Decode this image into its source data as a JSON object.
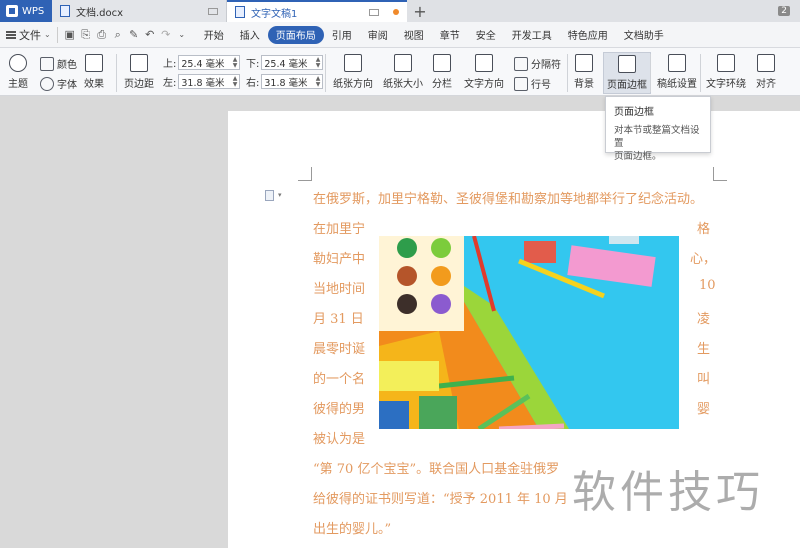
{
  "titlebar": {
    "app_name": "WPS",
    "tabs": [
      {
        "label": "文档.docx"
      },
      {
        "label": "文字文稿1"
      }
    ],
    "badge": "2"
  },
  "menubar": {
    "file_label": "文件",
    "items": [
      "开始",
      "插入",
      "页面布局",
      "引用",
      "审阅",
      "视图",
      "章节",
      "安全",
      "开发工具",
      "特色应用",
      "文档助手"
    ],
    "active": "页面布局"
  },
  "ribbon": {
    "theme": "主题",
    "color": "颜色",
    "font": "字体",
    "effect": "效果",
    "margins": "页边距",
    "top_label": "上:",
    "top_value": "25.4 毫米",
    "bottom_label": "下:",
    "bottom_value": "25.4 毫米",
    "left_label": "左:",
    "left_value": "31.8 毫米",
    "right_label": "右:",
    "right_value": "31.8 毫米",
    "orientation": "纸张方向",
    "size": "纸张大小",
    "columns": "分栏",
    "text_direction": "文字方向",
    "separator": "分隔符",
    "line_number": "行号",
    "background": "背景",
    "page_border": "页面边框",
    "draft_settings": "稿纸设置",
    "text_wrap": "文字环绕",
    "align": "对齐"
  },
  "tooltip": {
    "title": "页面边框",
    "desc_line1": "对本节或整篇文档设置",
    "desc_line2": "页面边框。"
  },
  "document": {
    "line1": "在俄罗斯，加里宁格勒、圣彼得堡和勘察加等地都举行了纪念活动。",
    "left_lines": [
      "在加里宁",
      "勒妇产中",
      "当地时间",
      "月  31  日",
      "晨零时诞",
      "的一个名",
      "彼得的男",
      "被认为是"
    ],
    "right_lines": [
      "格",
      "心，",
      "10",
      "凌",
      "生",
      "叫",
      "婴"
    ],
    "line10": "“第 70 亿个宝宝”。联合国人口基金驻俄罗",
    "line11": "给彼得的证书则写道：“授予 2011 年 10 月",
    "line12": "出生的婴儿。”"
  },
  "watermark": "软件技巧",
  "colors": {
    "accent": "#2f62b5",
    "doc_text": "#e39a60",
    "tab_dot": "#f08a2b"
  }
}
